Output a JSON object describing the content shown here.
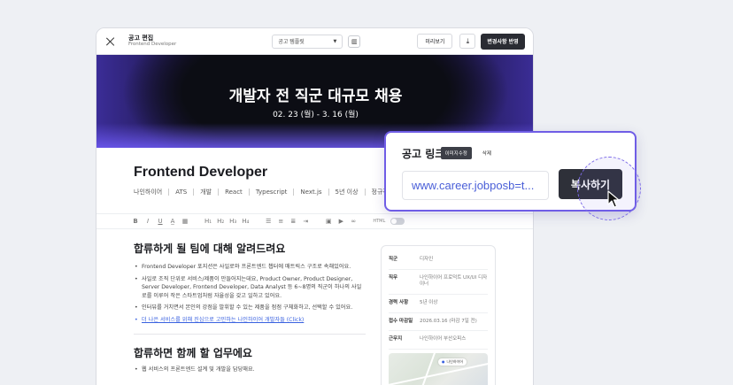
{
  "header": {
    "title": "공고 편집",
    "subtitle": "Frontend Developer",
    "template_select": "공고 템플릿",
    "preview": "미리보기",
    "apply": "변경사항 반영"
  },
  "hero": {
    "title": "개발자 전 직군 대규모 채용",
    "date": "02. 23 (월) - 3. 16 (월)",
    "image_edit": "이미지수정",
    "image_delete": "삭제"
  },
  "job": {
    "title": "Frontend Developer",
    "tags": [
      "나인하이어",
      "ATS",
      "개발",
      "React",
      "Typescript",
      "Next.js",
      "5년 이상",
      "정규직"
    ]
  },
  "toolbar": {
    "html_label": "HTML"
  },
  "content": {
    "heading1": "합류하게 될 팀에 대해 알려드려요",
    "bullets": [
      "Frontend Developer 포지션은 사일로와 프론트엔드 챕터에 매트릭스 구조로 속해있어요.",
      "사일로 조직 단위로 서비스/제품이 만들어지는데요, Product Owner, Product Designer, Server Developer, Frontend Developer, Data Analyst 등 6~8명의 직군이 하나의 사일로를 이루어 작은 스타트업처럼 자율성을 갖고 일하고 있어요.",
      "인터뷰를 거치면서 본인의 강점을 발휘할 수 있는 제품을 점점 구체화하고, 선택할 수 있어요."
    ],
    "link": "더 나은 서비스를 위해 진심으로 고민하는 나인하이어 개발자들 (Click)",
    "heading2": "합류하면 함께 할 업무에요",
    "heading2_bullet": "웹 서비스의 프론트엔드 설계 및 개발을 담당해요."
  },
  "summary": [
    {
      "key": "직군",
      "value": "디자인"
    },
    {
      "key": "직무",
      "value": "나인하이어 프로덕트 UX/UI 디자이너"
    },
    {
      "key": "경력 사항",
      "value": "5년 이상"
    },
    {
      "key": "접수 마감일",
      "value": "2026.03.16 (마감 7일 전)"
    },
    {
      "key": "근무지",
      "value": "나인하이어 부산오피스"
    }
  ],
  "map": {
    "pin_label": "나인하이어"
  },
  "popup": {
    "title": "공고 링크",
    "url": "www.career.jobposb=t...",
    "copy": "복사하기"
  },
  "colors": {
    "accent": "#6f5de6",
    "dark_button": "#2e3039",
    "link": "#3a62e0"
  }
}
